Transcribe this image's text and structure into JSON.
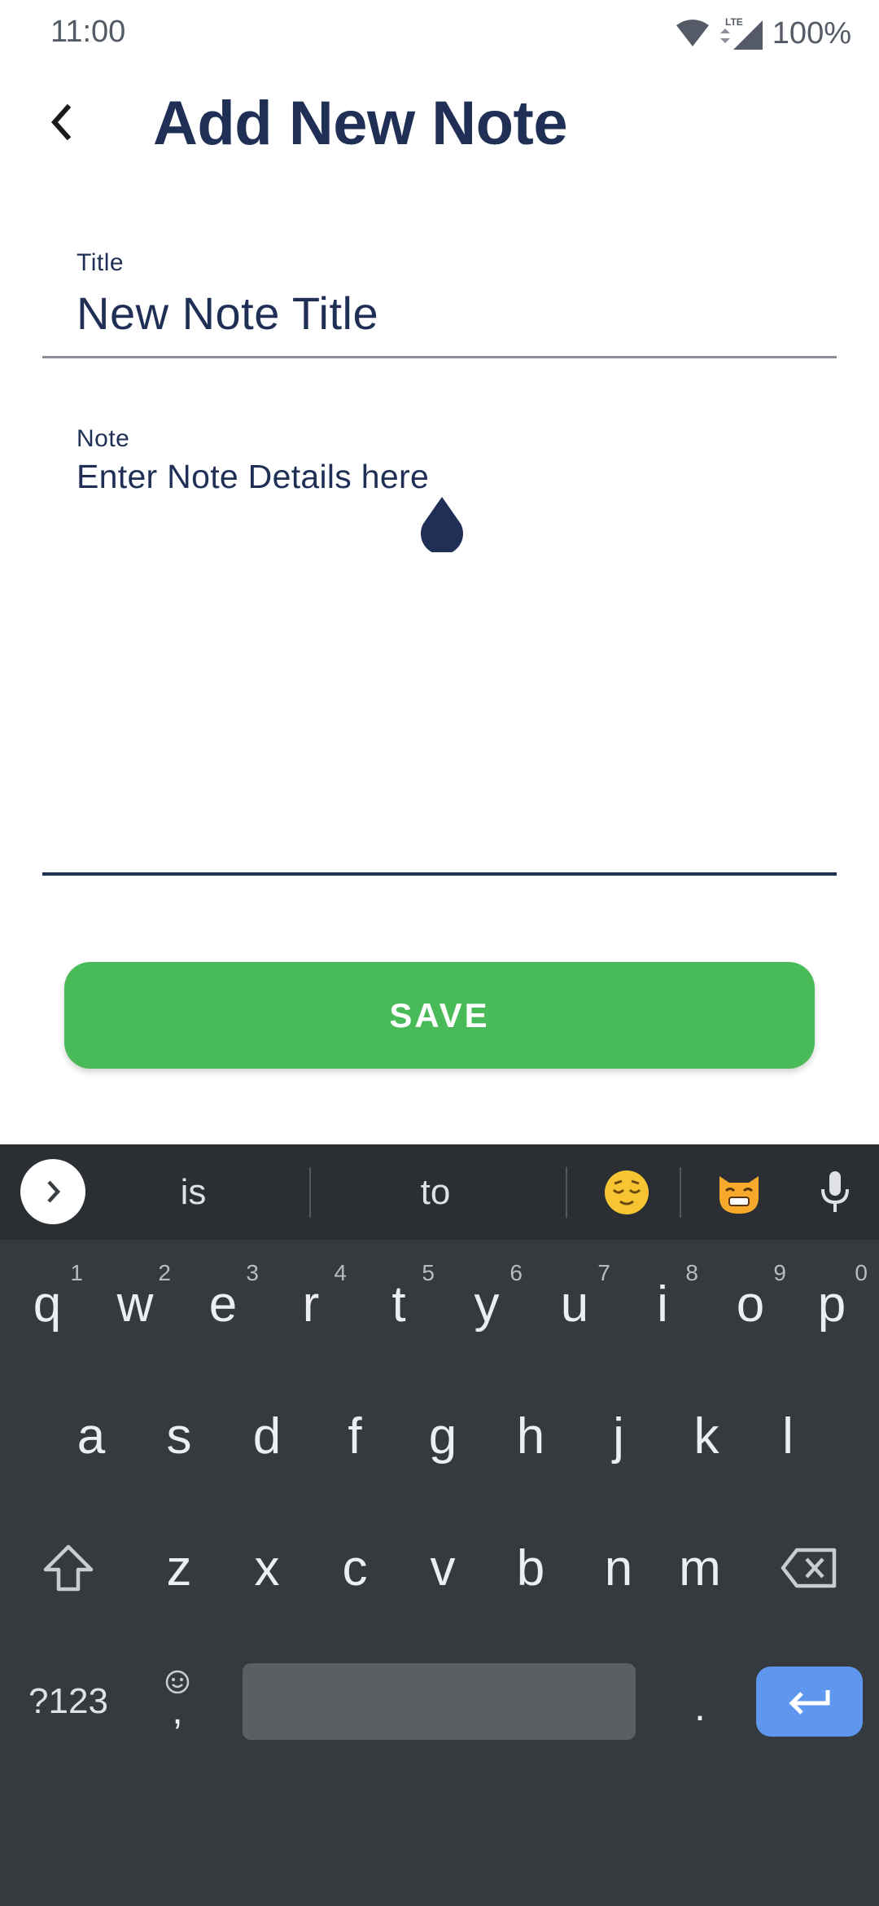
{
  "status_bar": {
    "time": "11:00",
    "network": "LTE",
    "battery": "100%"
  },
  "app_bar": {
    "back_icon": "chevron-left-icon",
    "title": "Add New Note"
  },
  "form": {
    "title_label": "Title",
    "title_value": "New Note Title",
    "note_label": "Note",
    "note_value": "Enter Note Details here"
  },
  "save_button": {
    "label": "SAVE",
    "color": "#48bb58"
  },
  "colors": {
    "primary": "#1f2f55",
    "keyboard_bg": "#353a3f",
    "suggest_bg": "#2b2f33",
    "enter_key": "#5f97ef"
  },
  "keyboard": {
    "suggestions": [
      "is",
      "to"
    ],
    "emoji_suggestions": [
      "relieved-face-emoji",
      "grinning-cat-emoji"
    ],
    "row1": [
      {
        "key": "q",
        "hint": "1"
      },
      {
        "key": "w",
        "hint": "2"
      },
      {
        "key": "e",
        "hint": "3"
      },
      {
        "key": "r",
        "hint": "4"
      },
      {
        "key": "t",
        "hint": "5"
      },
      {
        "key": "y",
        "hint": "6"
      },
      {
        "key": "u",
        "hint": "7"
      },
      {
        "key": "i",
        "hint": "8"
      },
      {
        "key": "o",
        "hint": "9"
      },
      {
        "key": "p",
        "hint": "0"
      }
    ],
    "row2": [
      "a",
      "s",
      "d",
      "f",
      "g",
      "h",
      "j",
      "k",
      "l"
    ],
    "row3": [
      "z",
      "x",
      "c",
      "v",
      "b",
      "n",
      "m"
    ],
    "symbols_key": "?123",
    "comma_key": ",",
    "period_key": "."
  }
}
